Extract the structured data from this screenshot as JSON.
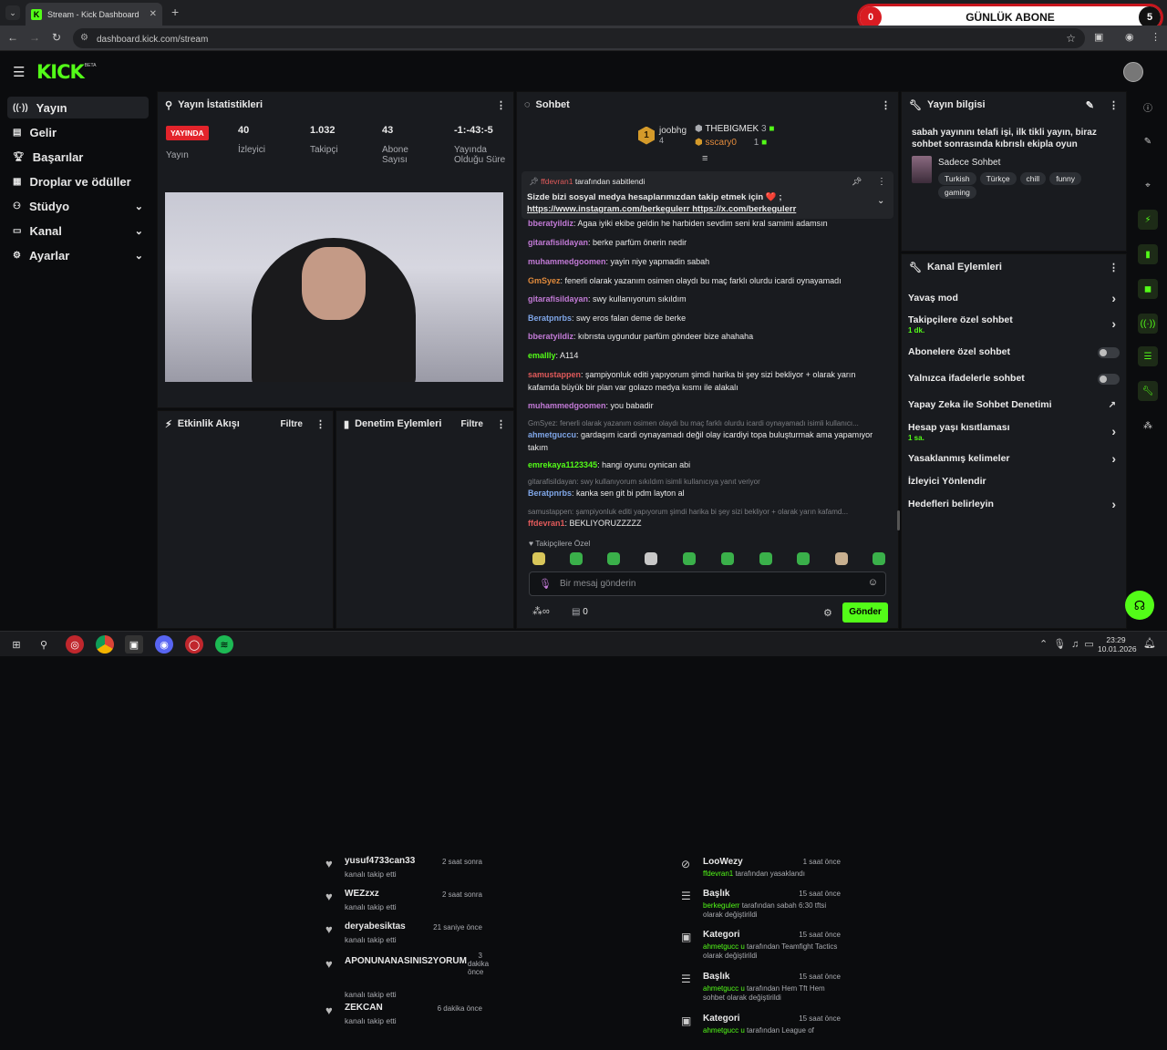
{
  "browser": {
    "tab_title": "Stream - Kick Dashboard",
    "url": "dashboard.kick.com/stream"
  },
  "overlay": {
    "left_count": "0",
    "title": "GÜNLÜK ABONE",
    "right_count": "5"
  },
  "brand": {
    "logo": "KICK",
    "beta": "BETA"
  },
  "sidebar": {
    "items": [
      {
        "label": "Yayın",
        "icon": "broadcast-icon"
      },
      {
        "label": "Gelir",
        "icon": "money-icon"
      },
      {
        "label": "Başarılar",
        "icon": "trophy-icon"
      },
      {
        "label": "Droplar ve ödüller",
        "icon": "gift-icon"
      },
      {
        "label": "Stüdyo",
        "icon": "studio-icon"
      },
      {
        "label": "Kanal",
        "icon": "channel-icon"
      },
      {
        "label": "Ayarlar",
        "icon": "gear-icon"
      }
    ]
  },
  "stats": {
    "title": "Yayın İstatistikleri",
    "live_badge": "YAYINDA",
    "live_label": "Yayın",
    "items": [
      {
        "value": "40",
        "label": "İzleyici"
      },
      {
        "value": "1.032",
        "label": "Takipçi"
      },
      {
        "value": "43",
        "label": "Abone Sayısı"
      },
      {
        "value": "-1:-43:-5",
        "label": "Yayında Olduğu Süre"
      }
    ]
  },
  "activity": {
    "title": "Etkinlik Akışı",
    "filter": "Filtre",
    "items": [
      {
        "name": "yusuf4733can33",
        "action": "kanalı takip etti",
        "time": "2 saat sonra"
      },
      {
        "name": "WEZzxz",
        "action": "kanalı takip etti",
        "time": "2 saat sonra"
      },
      {
        "name": "deryabesiktas",
        "action": "kanalı takip etti",
        "time": "21 saniye önce"
      },
      {
        "name": "APONUNANASINIS2YORUM",
        "action": "kanalı takip etti",
        "time": "3 dakika önce"
      },
      {
        "name": "ZEKCAN",
        "action": "kanalı takip etti",
        "time": "6 dakika önce"
      }
    ]
  },
  "moderation": {
    "title": "Denetim Eylemleri",
    "filter": "Filtre",
    "items": [
      {
        "title": "LooWezy",
        "user": "ffdevran1",
        "desc": "tarafından yasaklandı",
        "time": "1 saat önce"
      },
      {
        "title": "Başlık",
        "user": "berkegulerr",
        "desc": "tarafından sabah 6:30 tftsi olarak değiştirildi",
        "time": "15 saat önce"
      },
      {
        "title": "Kategori",
        "user": "ahmetgucc u",
        "desc": "tarafından Teamfight Tactics olarak değiştirildi",
        "time": "15 saat önce"
      },
      {
        "title": "Başlık",
        "user": "ahmetgucc u",
        "desc": "tarafından Hem Tft Hem sohbet olarak değiştirildi",
        "time": "15 saat önce"
      },
      {
        "title": "Kategori",
        "user": "ahmetgucc u",
        "desc": "tarafından League of",
        "time": "15 saat önce"
      }
    ]
  },
  "chat": {
    "title": "Sohbet",
    "top": [
      {
        "rank": "1",
        "name": "joobhg",
        "count": "4"
      },
      {
        "name": "THEBIGMEK",
        "count": "3"
      },
      {
        "name": "sscary0",
        "count": "1"
      }
    ],
    "pinned": {
      "by": "ffdevran1",
      "by_suffix": "tarafından sabitlendi",
      "text": "Sizde bizi sosyal medya hesaplarımızdan takip etmek için ❤️ ;",
      "link1": "https://www.instagram.com/berkegulerr",
      "link2": "https://x.com/berkegulerr"
    },
    "messages": [
      {
        "name": "bberatyildiz",
        "text": "Agaa iyiki ekibe geldin he harbiden sevdim seni kral samimi adamsın",
        "color": "#c27ad6"
      },
      {
        "name": "gitarafisildayan",
        "text": "berke parfüm önerin nedir",
        "color": "#c27ad6"
      },
      {
        "name": "muhammedgoomen",
        "text": "yayin niye yapmadin sabah",
        "color": "#c27ad6"
      },
      {
        "name": "GmSyez",
        "text": "fenerli olarak yazanım osimen olaydı bu maç farklı olurdu icardi oynayamadı",
        "color": "#e08a3c"
      },
      {
        "name": "gitarafisildayan",
        "text": "swy kullanıyorum sıkıldım",
        "color": "#c27ad6"
      },
      {
        "name": "Beratpnrbs",
        "text": "swy eros falan deme de berke",
        "color": "#7fa6e8"
      },
      {
        "name": "bberatyildiz",
        "text": "kıbrısta uygundur parfüm göndeer bize ahahaha",
        "color": "#c27ad6"
      },
      {
        "name": "emallly",
        "text": "A114",
        "color": "#53fc18"
      },
      {
        "name": "samustappen",
        "text": "şampiyonluk editi yapıyorum şimdi harika bi şey sizi bekliyor + olarak yarın kafamda büyük bir plan var golazo medya kısmı ile alakalı",
        "color": "#e05a5a"
      },
      {
        "name": "muhammedgoomen",
        "text": "you babadir",
        "color": "#c27ad6"
      },
      {
        "reply": "GmSyez: fenerli olarak yazanım osimen olaydı bu maç farklı olurdu icardi oynayamadı isimli kullanıcı...",
        "name": "ahmetguccu",
        "text": "gardaşım icardi oynayamadı değil olay icardiyi topa buluşturmak ama yapamıyor takım",
        "color": "#7fa6e8"
      },
      {
        "name": "emrekaya1123345",
        "text": "hangi oyunu oynican abi",
        "color": "#53fc18"
      },
      {
        "reply": "gitarafisildayan: swy kullanıyorum sıkıldım isimli kullanıcıya yanıt veriyor",
        "name": "Beratpnrbs",
        "text": "kanka sen git bi pdm layton al",
        "color": "#7fa6e8"
      },
      {
        "reply": "samustappen: şampiyonluk editi yapıyorum şimdi harika bi şey sizi bekliyor + olarak yarın kafamd...",
        "name": "ffdevran1",
        "text": "BEKLIYORUZZZZZ",
        "color": "#e05a5a"
      }
    ],
    "followers_only": "Takipçilere Özel",
    "input_placeholder": "Bir mesaj gönderin",
    "points": "0",
    "send": "Gönder"
  },
  "stream_info": {
    "title": "Yayın bilgisi",
    "stream_title": "sabah yayınını telafi işi, ilk tikli yayın, biraz sohbet sonrasında kıbrıslı ekipla oyun",
    "category": "Sadece Sohbet",
    "tags": [
      "Turkish",
      "Türkçe",
      "chill",
      "funny",
      "gaming"
    ]
  },
  "channel_actions": {
    "title": "Kanal Eylemleri",
    "items": [
      {
        "label": "Yavaş mod",
        "type": "chev"
      },
      {
        "label": "Takipçilere özel sohbet",
        "sub": "1 dk.",
        "type": "chev"
      },
      {
        "label": "Abonelere özel sohbet",
        "type": "toggle"
      },
      {
        "label": "Yalnızca ifadelerle sohbet",
        "type": "toggle"
      },
      {
        "label": "Yapay Zeka ile Sohbet Denetimi",
        "type": "ext"
      },
      {
        "label": "Hesap yaşı kısıtlaması",
        "sub": "1 sa.",
        "type": "chev"
      },
      {
        "label": "Yasaklanmış kelimeler",
        "type": "chev"
      },
      {
        "label": "İzleyici Yönlendir",
        "type": "none"
      },
      {
        "label": "Hedefleri belirleyin",
        "type": "chev"
      }
    ]
  },
  "taskbar": {
    "time": "23:29",
    "date": "10.01.2026"
  },
  "colors": {
    "accent": "#53fc18",
    "live": "#e3242b",
    "panel": "#191b1f"
  }
}
